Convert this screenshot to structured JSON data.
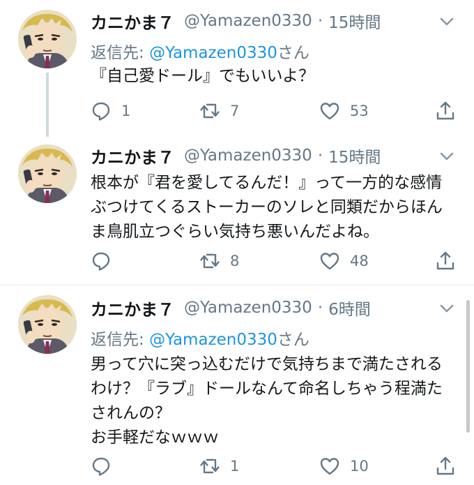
{
  "tweets": [
    {
      "name": "カニかま７",
      "handle": "@Yamazen0330",
      "dot": "·",
      "time": "15時間",
      "replying_prefix": "返信先: ",
      "replying_mention": "@Yamazen0330",
      "replying_suffix": "さん",
      "lines": [
        "『自己愛ドール』でもいいよ？"
      ],
      "reply_count": "1",
      "retweet_count": "7",
      "like_count": "53"
    },
    {
      "name": "カニかま７",
      "handle": "@Yamazen0330",
      "dot": "·",
      "time": "15時間",
      "lines": [
        "根本が『君を愛してるんだ！』って一方的な感情",
        "ぶつけてくるストーカーのソレと同類だからほん",
        "ま鳥肌立つぐらい気持ち悪いんだよね。"
      ],
      "reply_count": "",
      "retweet_count": "8",
      "like_count": "48"
    },
    {
      "name": "カニかま７",
      "handle": "@Yamazen0330",
      "dot": "·",
      "time": "6時間",
      "replying_prefix": "返信先: ",
      "replying_mention": "@Yamazen0330",
      "replying_suffix": "さん",
      "lines": [
        "男って穴に突っ込むだけで気持ちまで満たされる",
        "わけ？『ラブ』ドールなんて命名しちゃう程満た",
        "されんの？",
        "お手軽だなｗｗｗ"
      ],
      "reply_count": "",
      "retweet_count": "1",
      "like_count": "10"
    }
  ],
  "icons": {
    "more": "chevron-down-icon",
    "reply": "reply-icon",
    "retweet": "retweet-icon",
    "like": "heart-icon",
    "share": "share-icon"
  },
  "colors": {
    "link": "#1b95e0",
    "secondary": "#657786",
    "divider": "#e1e8ed"
  }
}
